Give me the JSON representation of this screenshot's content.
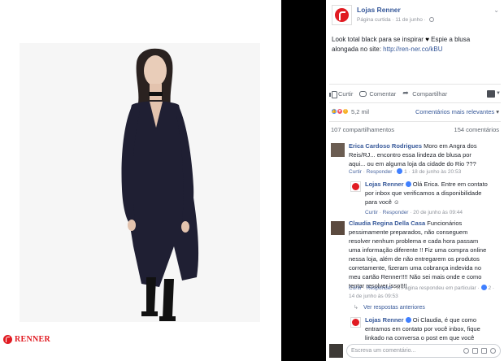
{
  "photo": {
    "brand": "RENNER",
    "colors": {
      "brand_red": "#e11b22",
      "dress": "#1c1c2e"
    }
  },
  "post": {
    "page_name": "Lojas Renner",
    "meta_prefix": "Página curtida",
    "meta_date": "11 de junho",
    "text_main": "Look total black para se inspirar",
    "text_tail": "Espie a blusa alongada no site:",
    "link": "http://ren-ner.co/kBU",
    "heart": "♥"
  },
  "actions": {
    "like": "Curtir",
    "comment": "Comentar",
    "share": "Compartilhar"
  },
  "reactions": {
    "count": "5,2 mil",
    "sort_label": "Comentários mais relevantes",
    "shares": "107 compartilhamentos",
    "comments_count": "154 comentários"
  },
  "comments": [
    {
      "name": "Erica Cardoso Rodrigues",
      "text": "Moro em Angra dos Reis/RJ... encontro essa lindeza de blusa por aqui... ou em alguma loja da cidade do Rio ???",
      "reply": "Curtir",
      "respond": "Responder",
      "likes": "1",
      "time": "18 de junho às 20:53"
    },
    {
      "name": "Lojas Renner",
      "text": "Olá Erica. Entre em contato por inbox que verificamos a disponibilidade para você",
      "emoji": "☺",
      "reply": "Curtir",
      "respond": "Responder",
      "time": "20 de junho às 09:44"
    },
    {
      "name": "Claudia Regina Della Casa",
      "text": "Funcionários pessimamente preparados, não conseguem resolver nenhum problema e cada hora passam uma informação diferente !! Fiz uma compra online nessa loja, além de não entregarem os produtos corretamente, fizeram uma cobrança indevida no meu cartão Renner!!!! Não sei mais onde e como tentar resolver isso!!!!",
      "reply": "Curtir",
      "respond": "Responder",
      "page_replied": "A Página respondeu em particular",
      "likes": "2",
      "time": "14 de junho às 09:53",
      "more": "Ver respostas anteriores"
    },
    {
      "name": "Lojas Renner",
      "text": "Oi Claudia, é que como entramos em contato por você inbox, fique linkado na conversa o post em que você"
    }
  ],
  "composer": {
    "placeholder": "Escreva um comentário..."
  }
}
